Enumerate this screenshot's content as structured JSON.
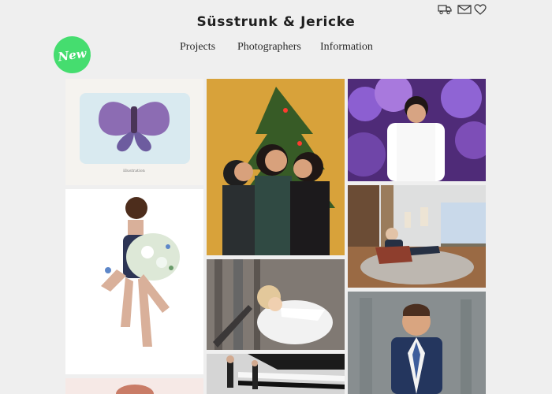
{
  "header": {
    "brand": "Süsstrunk & Jericke",
    "badge": "New",
    "nav": [
      "Projects",
      "Photographers",
      "Information"
    ],
    "icons": [
      "truck-icon",
      "mail-icon",
      "heart-icon"
    ]
  },
  "gallery": {
    "items": [
      "butterfly-perfume-illustration",
      "fashion-bouquet-portrait",
      "family-christmas-photo",
      "man-in-garden-portrait",
      "living-room-businessman",
      "woman-lying-portrait",
      "suit-portrait",
      "street-fashion-scene"
    ]
  },
  "colors": {
    "background": "#efefef",
    "badge": "#45dd6f",
    "text": "#2a2a2a"
  }
}
